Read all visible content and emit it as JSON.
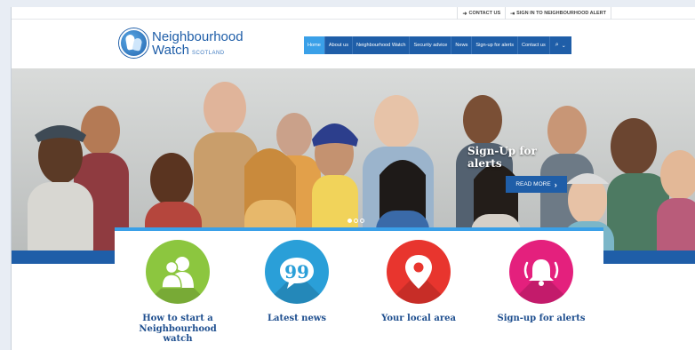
{
  "topbar": {
    "contact_label": "CONTACT US",
    "signin_label": "SIGN IN TO NEIGHBOURHOOD ALERT"
  },
  "logo": {
    "line1": "Neighbourhood",
    "line2": "Watch",
    "sub": "SCOTLAND"
  },
  "nav": {
    "items": [
      {
        "label": "Home"
      },
      {
        "label": "About us"
      },
      {
        "label": "Neighbourhood Watch"
      },
      {
        "label": "Security advice"
      },
      {
        "label": "News"
      },
      {
        "label": "Sign-up for alerts"
      },
      {
        "label": "Contact us"
      }
    ],
    "search_label": "⌕ ⌄"
  },
  "hero": {
    "caption": "Sign-Up for alerts",
    "button_label": "READ MORE"
  },
  "features": [
    {
      "label": "How to start a Neighbourhood watch",
      "color": "#8cc63f",
      "icon": "people-icon"
    },
    {
      "label": "Latest news",
      "color": "#2a9fd8",
      "icon": "speech-bubble-icon"
    },
    {
      "label": "Your local area",
      "color": "#e8352e",
      "icon": "map-pin-icon"
    },
    {
      "label": "Sign-up for alerts",
      "color": "#e4207d",
      "icon": "alarm-bell-icon"
    }
  ],
  "colors": {
    "brand_blue": "#1f5ea8",
    "accent_blue": "#3aa0e8"
  }
}
